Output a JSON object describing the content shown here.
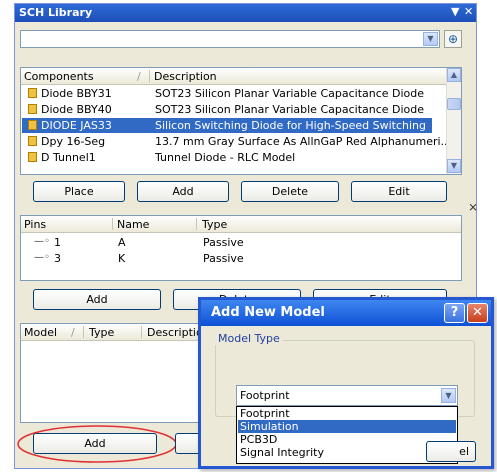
{
  "panel": {
    "title": "SCH Library",
    "title_controls": [
      "▼",
      "✕"
    ],
    "filter_value": "",
    "components": {
      "columns": [
        "Components",
        "Description"
      ],
      "rows": [
        {
          "name": "Diode BBY31",
          "description": "SOT23 Silicon Planar Variable Capacitance Diode",
          "selected": false
        },
        {
          "name": "Diode BBY40",
          "description": "SOT23 Silicon Planar Variable Capacitance Diode",
          "selected": false
        },
        {
          "name": "DIODE JAS33",
          "description": "Silicon Switching Diode for High-Speed Switching",
          "selected": true
        },
        {
          "name": "Dpy 16-Seg",
          "description": "13.7 mm Gray Surface As AllnGaP Red Alphanumeri...",
          "selected": false
        },
        {
          "name": "D Tunnel1",
          "description": "Tunnel Diode - RLC Model",
          "selected": false
        }
      ],
      "buttons": [
        "Place",
        "Add",
        "Delete",
        "Edit"
      ]
    },
    "pins": {
      "columns": [
        "Pins",
        "Name",
        "Type"
      ],
      "rows": [
        {
          "pin": "1",
          "name": "A",
          "type": "Passive"
        },
        {
          "pin": "3",
          "name": "K",
          "type": "Passive"
        }
      ],
      "buttons": [
        "Add",
        "Delete",
        "Edit"
      ]
    },
    "models": {
      "columns": [
        "Model",
        "Type",
        "Description"
      ],
      "buttons": [
        "Add"
      ]
    }
  },
  "dialog": {
    "title": "Add New Model",
    "help": "?",
    "close": "✕",
    "group_label": "Model Type",
    "selected": "Footprint",
    "options": [
      "Footprint",
      "Simulation",
      "PCB3D",
      "Signal Integrity"
    ],
    "highlighted_index": 1,
    "cancel_fragment": "el"
  },
  "colors": {
    "title_blue": "#2E6BD8",
    "selection": "#316AC5",
    "panel_bg": "#ECE9D8",
    "highlight_oval": "#E03030"
  }
}
